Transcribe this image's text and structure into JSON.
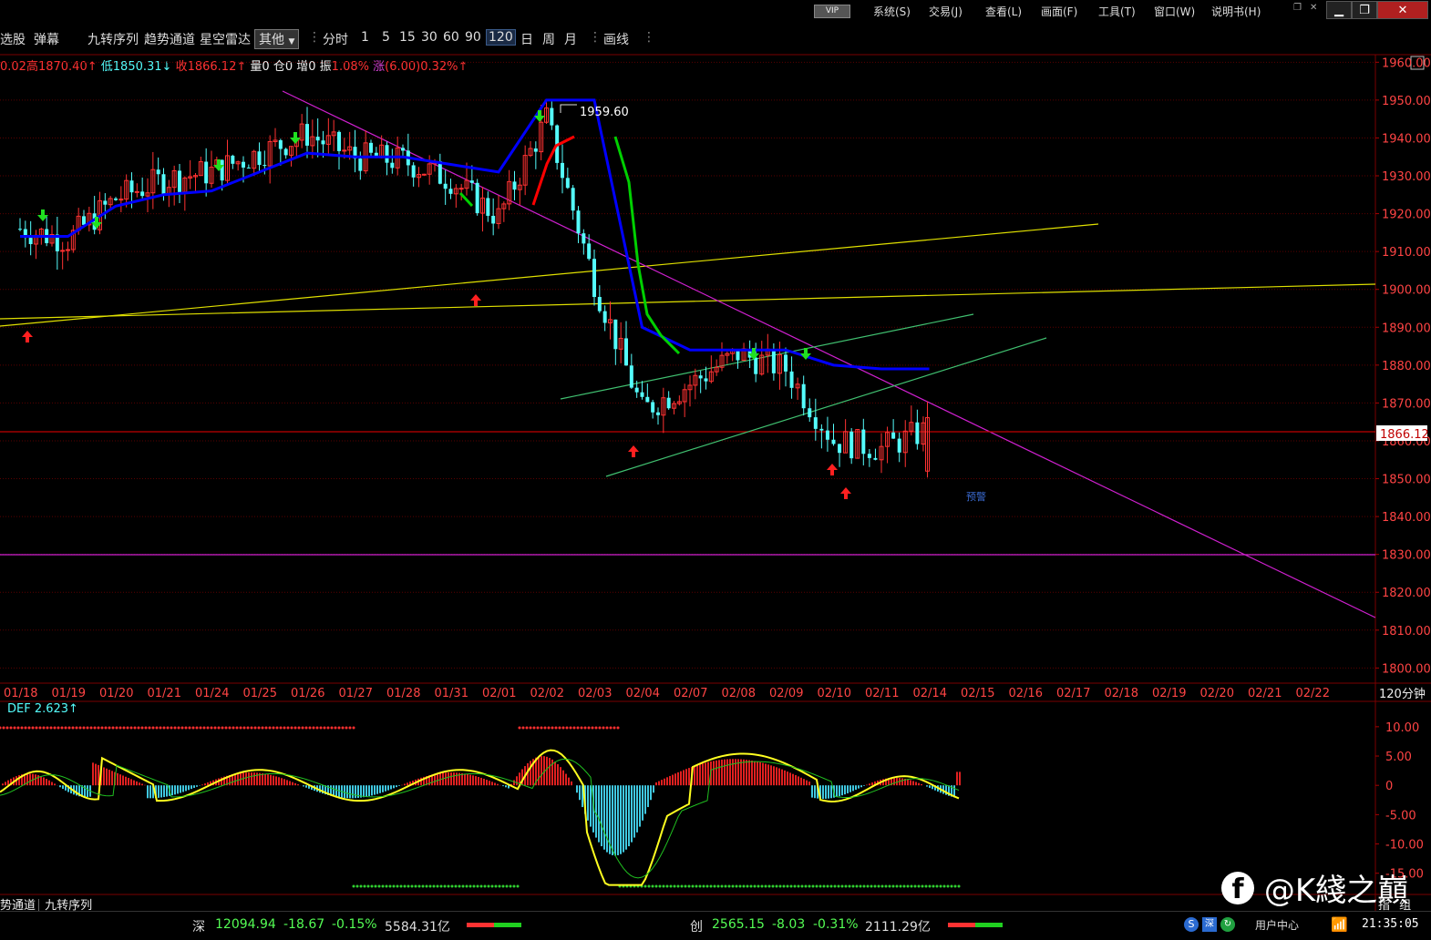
{
  "menubar": {
    "vip": "VIP",
    "items": [
      "系统(S)",
      "交易(J)",
      "查看(L)",
      "画面(F)",
      "工具(T)",
      "窗口(W)",
      "说明书(H)"
    ]
  },
  "toolbar": {
    "items": [
      "选股",
      "弹幕",
      "九转序列",
      "趋势通道",
      "星空雷达"
    ],
    "dropdown_value": "其他",
    "periods": [
      "分时",
      "1",
      "5",
      "15",
      "30",
      "60",
      "90",
      "120",
      "日",
      "周",
      "月"
    ],
    "active_period": "120",
    "draw": "画线"
  },
  "infobar": {
    "open": "0.02",
    "high_label": "高",
    "high": "1870.40↑",
    "low_label": "低",
    "low": "1850.31↓",
    "close_label": "收",
    "close": "1866.12↑",
    "vol": "量0",
    "oi": "仓0",
    "add": "增0",
    "amp_label": "振",
    "amp": "1.08%",
    "rise_label": "涨",
    "rise": "(6.00)0.32%↑"
  },
  "chart_data": {
    "type": "candlestick",
    "period": "120分钟",
    "y_ticks": [
      "1960.00",
      "1950.00",
      "1940.00",
      "1930.00",
      "1920.00",
      "1910.00",
      "1900.00",
      "1890.00",
      "1880.00",
      "1870.00",
      "1860.00",
      "1850.00",
      "1840.00",
      "1830.00",
      "1820.00",
      "1810.00",
      "1800.00"
    ],
    "ylim": [
      1796,
      1962
    ],
    "x_labels": [
      "01/18",
      "01/19",
      "01/20",
      "01/21",
      "01/24",
      "01/25",
      "01/26",
      "01/27",
      "01/28",
      "01/31",
      "02/01",
      "02/02",
      "02/03",
      "02/04",
      "02/07",
      "02/08",
      "02/09",
      "02/10",
      "02/11",
      "02/14",
      "02/15",
      "02/16",
      "02/17",
      "02/18",
      "02/19",
      "02/20",
      "02/21",
      "02/22"
    ],
    "last_price": "1866.12",
    "high_annotation": "1959.60",
    "forecast_label": "预警",
    "trend_line": [
      1916,
      1913,
      1924,
      1929,
      1931,
      1936,
      1941,
      1935,
      1934,
      1929,
      1919,
      1945,
      1902,
      1868,
      1875,
      1883,
      1879,
      1860,
      1858,
      1863
    ],
    "blue_line": [
      1914,
      1914,
      1922,
      1925,
      1926,
      1931,
      1936,
      1935,
      1935,
      1933,
      1931,
      1950,
      1950,
      1890,
      1884,
      1884,
      1884,
      1880,
      1879,
      1879
    ],
    "indicator": {
      "name": "DEF",
      "value": "2.623↑",
      "y_ticks": [
        "10.00",
        "5.00",
        "0",
        "-5.00",
        "-10.00",
        "-15.00"
      ],
      "ylim": [
        -18,
        12
      ]
    }
  },
  "tabs": [
    "势通道",
    "九转序列"
  ],
  "right_tabs": [
    "指",
    "组"
  ],
  "status": {
    "sz_label": "深",
    "sz_index": "12094.94",
    "sz_change": "-18.67",
    "sz_pct": "-0.15%",
    "sz_amount": "5584.31亿",
    "cy_label": "创",
    "cy_index": "2565.15",
    "cy_change": "-8.03",
    "cy_pct": "-0.31%",
    "cy_amount": "2111.29亿",
    "user_center": "用户中心",
    "time": "21:35:05"
  },
  "watermark": "@K綫之巔",
  "colors": {
    "up": "#ff3232",
    "down": "#54fcfc",
    "ma": "#0000ff",
    "trend_up": "#ff0000",
    "trend_down": "#00d000"
  }
}
